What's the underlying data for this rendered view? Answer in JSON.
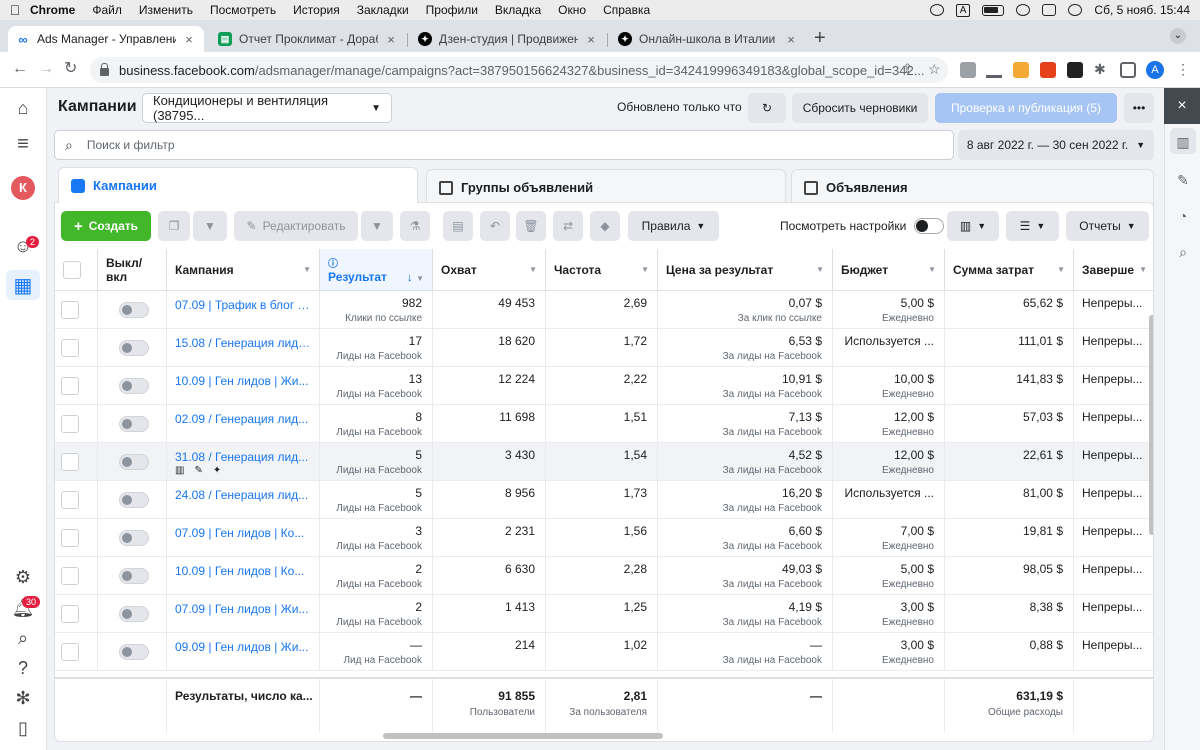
{
  "mac_menu": {
    "app": "Chrome",
    "items": [
      "Файл",
      "Изменить",
      "Посмотреть",
      "История",
      "Закладки",
      "Профили",
      "Вкладка",
      "Окно",
      "Справка"
    ],
    "clock": "Сб, 5 нояб.  15:44",
    "lang": "A"
  },
  "browser": {
    "tabs": [
      {
        "title": "Ads Manager - Управление ре",
        "icon": "meta-icon",
        "color": "#1877f2",
        "active": true
      },
      {
        "title": "Отчет Проклимат - Доработа",
        "icon": "sheets-icon",
        "color": "#0f9d58",
        "active": false
      },
      {
        "title": "Дзен-студия | Продвижения с",
        "icon": "dzen-icon",
        "color": "#000000",
        "active": false
      },
      {
        "title": "Онлайн-школа в Италии 🇮🇹 ва",
        "icon": "dzen-icon",
        "color": "#000000",
        "active": false
      }
    ],
    "url_host": "business.facebook.com",
    "url_path": "/adsmanager/manage/campaigns?act=387950156624327&business_id=342419996349183&global_scope_id=342...",
    "profile_initial": "A"
  },
  "leftnav": {
    "avatar_initial": "К",
    "notif_badge_1": "2",
    "notif_badge_2": "30"
  },
  "header": {
    "title": "Кампании",
    "account": "Кондиционеры и вентиляция (38795...",
    "updated": "Обновлено только что",
    "discard": "Сбросить черновики",
    "publish": "Проверка и публикация (5)",
    "search_placeholder": "Поиск и фильтр",
    "date_range": "8 авг 2022 г. — 30 сен 2022 г."
  },
  "level_tabs": {
    "campaigns": "Кампании",
    "adsets": "Группы объявлений",
    "ads": "Объявления"
  },
  "toolbar": {
    "create": "Создать",
    "edit": "Редактировать",
    "rules": "Правила",
    "view_settings": "Посмотреть настройки",
    "reports": "Отчеты"
  },
  "columns": {
    "toggle": "Выкл/ вкл",
    "campaign": "Кампания",
    "result": "Результат",
    "reach": "Охват",
    "frequency": "Частота",
    "cost_per_result": "Цена за результат",
    "budget": "Бюджет",
    "amount_spent": "Сумма затрат",
    "ends": "Заверше"
  },
  "rows": [
    {
      "campaign": "07.09 | Трафик в блог -...",
      "result": "982",
      "result_sub": "Клики по ссылке",
      "reach": "49 453",
      "frequency": "2,69",
      "cpr": "0,07 $",
      "cpr_sub": "За клик по ссылке",
      "budget": "5,00 $",
      "budget_sub": "Ежедневно",
      "spent": "65,62 $",
      "ends": "Непреры..."
    },
    {
      "campaign": "15.08 / Генерация лидо...",
      "result": "17",
      "result_sub": "Лиды на Facebook",
      "reach": "18 620",
      "frequency": "1,72",
      "cpr": "6,53 $",
      "cpr_sub": "За лиды на Facebook",
      "budget": "Используется ...",
      "budget_sub": "",
      "spent": "111,01 $",
      "ends": "Непреры..."
    },
    {
      "campaign": "10.09 | Ген лидов | Жи...",
      "result": "13",
      "result_sub": "Лиды на Facebook",
      "reach": "12 224",
      "frequency": "2,22",
      "cpr": "10,91 $",
      "cpr_sub": "За лиды на Facebook",
      "budget": "10,00 $",
      "budget_sub": "Ежедневно",
      "spent": "141,83 $",
      "ends": "Непреры..."
    },
    {
      "campaign": "02.09 / Генерация лид...",
      "result": "8",
      "result_sub": "Лиды на Facebook",
      "reach": "11 698",
      "frequency": "1,51",
      "cpr": "7,13 $",
      "cpr_sub": "За лиды на Facebook",
      "budget": "12,00 $",
      "budget_sub": "Ежедневно",
      "spent": "57,03 $",
      "ends": "Непреры..."
    },
    {
      "campaign": "31.08 / Генерация лид...",
      "result": "5",
      "result_sub": "Лиды на Facebook",
      "reach": "3 430",
      "frequency": "1,54",
      "cpr": "4,52 $",
      "cpr_sub": "За лиды на Facebook",
      "budget": "12,00 $",
      "budget_sub": "Ежедневно",
      "spent": "22,61 $",
      "ends": "Непреры..."
    },
    {
      "campaign": "24.08 / Генерация лид...",
      "result": "5",
      "result_sub": "Лиды на Facebook",
      "reach": "8 956",
      "frequency": "1,73",
      "cpr": "16,20 $",
      "cpr_sub": "За лиды на Facebook",
      "budget": "Используется ...",
      "budget_sub": "",
      "spent": "81,00 $",
      "ends": "Непреры..."
    },
    {
      "campaign": "07.09 | Ген лидов | Ко...",
      "result": "3",
      "result_sub": "Лиды на Facebook",
      "reach": "2 231",
      "frequency": "1,56",
      "cpr": "6,60 $",
      "cpr_sub": "За лиды на Facebook",
      "budget": "7,00 $",
      "budget_sub": "Ежедневно",
      "spent": "19,81 $",
      "ends": "Непреры..."
    },
    {
      "campaign": "10.09 | Ген лидов | Ко...",
      "result": "2",
      "result_sub": "Лиды на Facebook",
      "reach": "6 630",
      "frequency": "2,28",
      "cpr": "49,03 $",
      "cpr_sub": "За лиды на Facebook",
      "budget": "5,00 $",
      "budget_sub": "Ежедневно",
      "spent": "98,05 $",
      "ends": "Непреры..."
    },
    {
      "campaign": "07.09 | Ген лидов | Жи...",
      "result": "2",
      "result_sub": "Лиды на Facebook",
      "reach": "1 413",
      "frequency": "1,25",
      "cpr": "4,19 $",
      "cpr_sub": "За лиды на Facebook",
      "budget": "3,00 $",
      "budget_sub": "Ежедневно",
      "spent": "8,38 $",
      "ends": "Непреры..."
    },
    {
      "campaign": "09.09 | Ген лидов | Жи...",
      "result": "—",
      "result_sub": "Лид на Facebook",
      "reach": "214",
      "frequency": "1,02",
      "cpr": "—",
      "cpr_sub": "За лиды на Facebook",
      "budget": "3,00 $",
      "budget_sub": "Ежедневно",
      "spent": "0,88 $",
      "ends": "Непреры..."
    }
  ],
  "totals": {
    "label": "Результаты, число ка...",
    "result": "—",
    "reach": "91 855",
    "reach_sub": "Пользователи",
    "frequency": "2,81",
    "frequency_sub": "За пользователя",
    "cpr": "—",
    "spent": "631,19 $",
    "spent_sub": "Общие расходы"
  }
}
